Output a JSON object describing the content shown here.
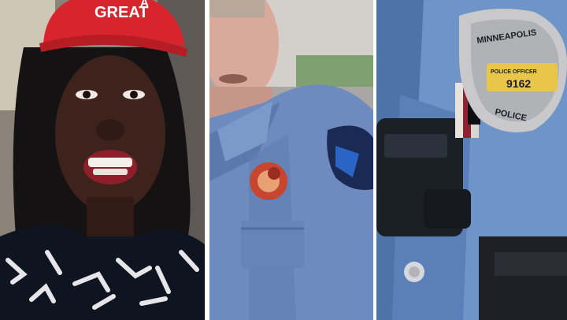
{
  "panels": [
    {
      "name": "woman-selfie",
      "cap_text": "GREAT",
      "cap_text_partial": "A"
    },
    {
      "name": "police-officer"
    },
    {
      "name": "badge-closeup",
      "badge_city": "MINNEAPOLIS",
      "badge_rank": "POLICE OFFICER",
      "badge_number": "9162",
      "badge_bottom": "POLICE"
    }
  ],
  "colors": {
    "cap_red": "#d8242c",
    "uniform_blue": "#6f94c8",
    "divider": "#ffffff"
  }
}
